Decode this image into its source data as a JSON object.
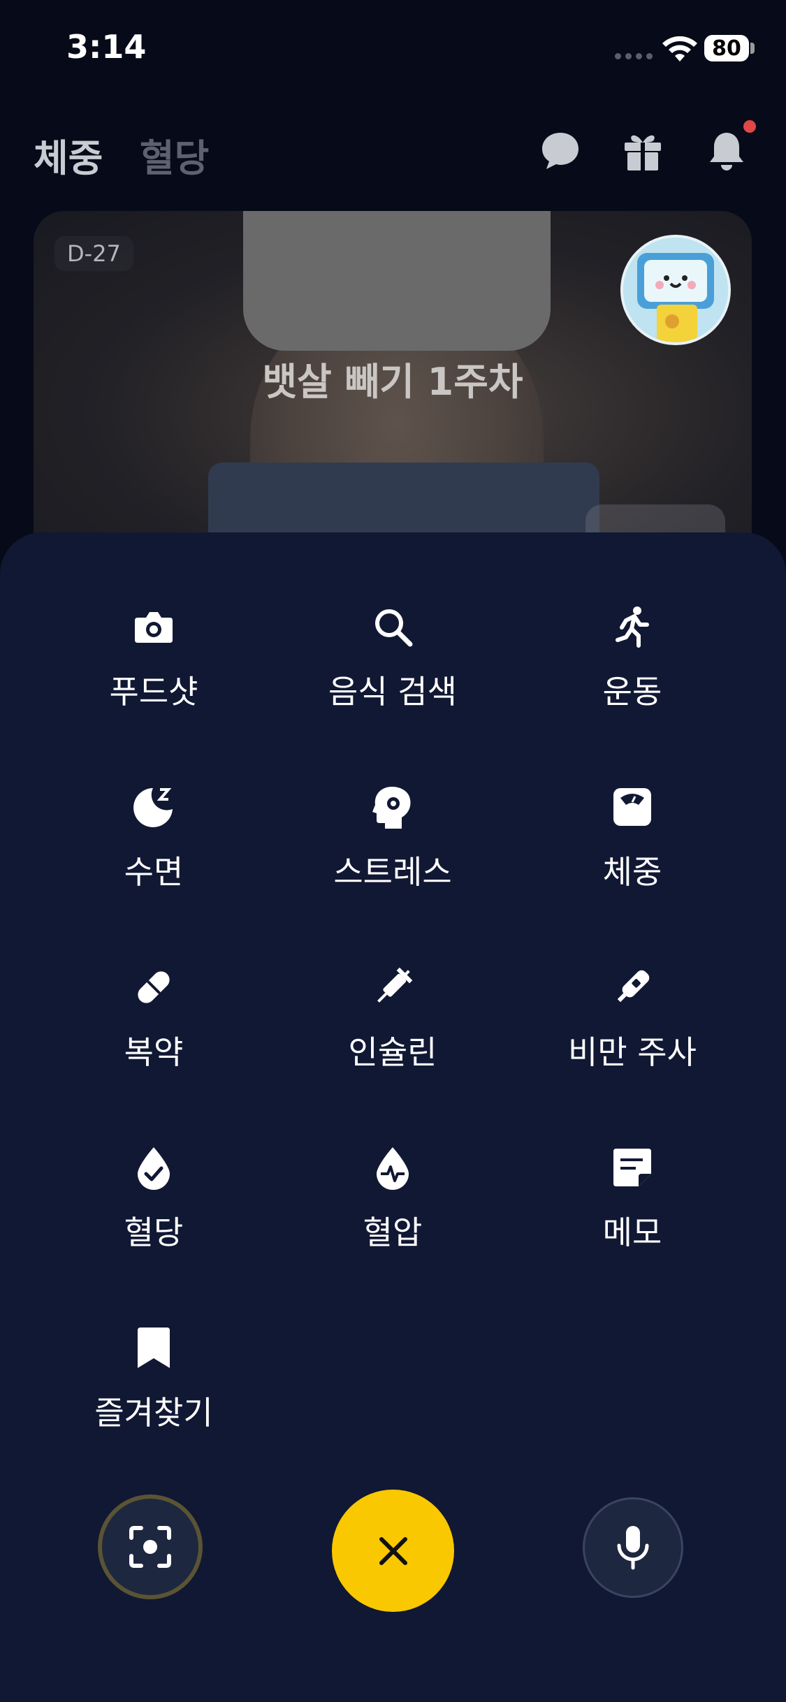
{
  "status_bar": {
    "time": "3:14",
    "battery": "80"
  },
  "top_nav": {
    "tabs": [
      {
        "label": "체중",
        "active": true
      },
      {
        "label": "혈당",
        "active": false
      }
    ],
    "icons": [
      "chat-bubble-icon",
      "gift-icon",
      "bell-icon"
    ]
  },
  "hero": {
    "dday": "D-27",
    "title": "뱃살 빼기 1주차"
  },
  "menu": {
    "items": [
      {
        "label": "푸드샷",
        "icon": "camera-icon"
      },
      {
        "label": "음식 검색",
        "icon": "search-icon"
      },
      {
        "label": "운동",
        "icon": "running-icon"
      },
      {
        "label": "수면",
        "icon": "moon-sleep-icon"
      },
      {
        "label": "스트레스",
        "icon": "head-brain-icon"
      },
      {
        "label": "체중",
        "icon": "scale-icon"
      },
      {
        "label": "복약",
        "icon": "pill-icon"
      },
      {
        "label": "인슐린",
        "icon": "syringe-icon"
      },
      {
        "label": "비만 주사",
        "icon": "injection-pen-icon"
      },
      {
        "label": "혈당",
        "icon": "drop-check-icon"
      },
      {
        "label": "혈압",
        "icon": "drop-pulse-icon"
      },
      {
        "label": "메모",
        "icon": "note-icon"
      },
      {
        "label": "즐겨찾기",
        "icon": "bookmark-icon"
      }
    ]
  },
  "bottom_actions": [
    "scan-camera-icon",
    "close-icon",
    "microphone-icon"
  ],
  "colors": {
    "background": "#070a18",
    "sheet": "#111833",
    "accent": "#f9c800",
    "notification": "#e04848"
  }
}
